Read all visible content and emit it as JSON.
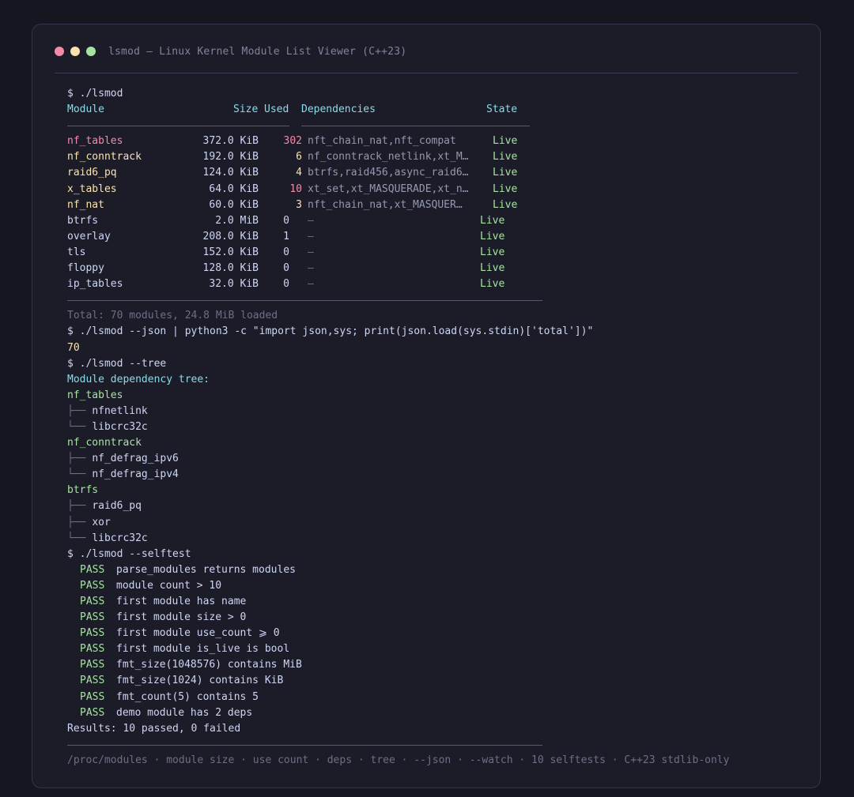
{
  "window": {
    "title": "lsmod — Linux Kernel Module List Viewer (C++23)"
  },
  "cmd1": "$ ./lsmod",
  "table": {
    "headers": {
      "module": "Module",
      "size": "Size",
      "used": "Used",
      "deps": "Dependencies",
      "state": "State"
    },
    "rows": [
      {
        "name": "nf_tables",
        "size": "372.0 KiB",
        "used": "302",
        "deps": "nft_chain_nat,nft_compat",
        "state": "Live"
      },
      {
        "name": "nf_conntrack",
        "size": "192.0 KiB",
        "used": "6",
        "deps": "nf_conntrack_netlink,xt_M…",
        "state": "Live"
      },
      {
        "name": "raid6_pq",
        "size": "124.0 KiB",
        "used": "4",
        "deps": "btrfs,raid456,async_raid6…",
        "state": "Live"
      },
      {
        "name": "x_tables",
        "size": "64.0 KiB",
        "used": "10",
        "deps": "xt_set,xt_MASQUERADE,xt_n…",
        "state": "Live"
      },
      {
        "name": "nf_nat",
        "size": "60.0 KiB",
        "used": "3",
        "deps": "nft_chain_nat,xt_MASQUER…",
        "state": "Live"
      },
      {
        "name": "btrfs",
        "size": "2.0 MiB",
        "used": "0",
        "deps": "—",
        "state": "Live"
      },
      {
        "name": "overlay",
        "size": "208.0 KiB",
        "used": "1",
        "deps": "—",
        "state": "Live"
      },
      {
        "name": "tls",
        "size": "152.0 KiB",
        "used": "0",
        "deps": "—",
        "state": "Live"
      },
      {
        "name": "floppy",
        "size": "128.0 KiB",
        "used": "0",
        "deps": "—",
        "state": "Live"
      },
      {
        "name": "ip_tables",
        "size": "32.0 KiB",
        "used": "0",
        "deps": "—",
        "state": "Live"
      }
    ],
    "total": "Total: 70 modules, 24.8 MiB loaded"
  },
  "cmd2": "$ ./lsmod --json | python3 -c \"import json,sys; print(json.load(sys.stdin)['total'])\"",
  "cmd2_output": "70",
  "cmd3": "$ ./lsmod --tree",
  "tree": {
    "heading": "Module dependency tree:",
    "groups": [
      {
        "root": "nf_tables",
        "children": [
          {
            "branch": "├── ",
            "name": "nfnetlink"
          },
          {
            "branch": "└── ",
            "name": "libcrc32c"
          }
        ]
      },
      {
        "root": "nf_conntrack",
        "children": [
          {
            "branch": "├── ",
            "name": "nf_defrag_ipv6"
          },
          {
            "branch": "└── ",
            "name": "nf_defrag_ipv4"
          }
        ]
      },
      {
        "root": "btrfs",
        "children": [
          {
            "branch": "├── ",
            "name": "raid6_pq"
          },
          {
            "branch": "├── ",
            "name": "xor"
          },
          {
            "branch": "└── ",
            "name": "libcrc32c"
          }
        ]
      }
    ]
  },
  "cmd4": "$ ./lsmod --selftest",
  "selftest": {
    "pass_label": "PASS",
    "tests": [
      "parse_modules returns modules",
      "module count > 10",
      "first module has name",
      "first module size > 0",
      "first module use_count ⩾ 0",
      "first module is_live is bool",
      "fmt_size(1048576) contains MiB",
      "fmt_size(1024) contains KiB",
      "fmt_count(5) contains 5",
      "demo module has 2 deps"
    ],
    "results": "Results: 10 passed, 0 failed"
  },
  "footer": "/proc/modules · module size · use count · deps · tree · --json · --watch · 10 selftests · C++23 stdlib-only",
  "colors": {
    "background": "#161621",
    "window": "#1c1c28",
    "cyan": "#89dceb",
    "green": "#a6e3a1",
    "pink": "#f38ba8",
    "yellow": "#f9e2af",
    "dim": "#6c7086"
  }
}
